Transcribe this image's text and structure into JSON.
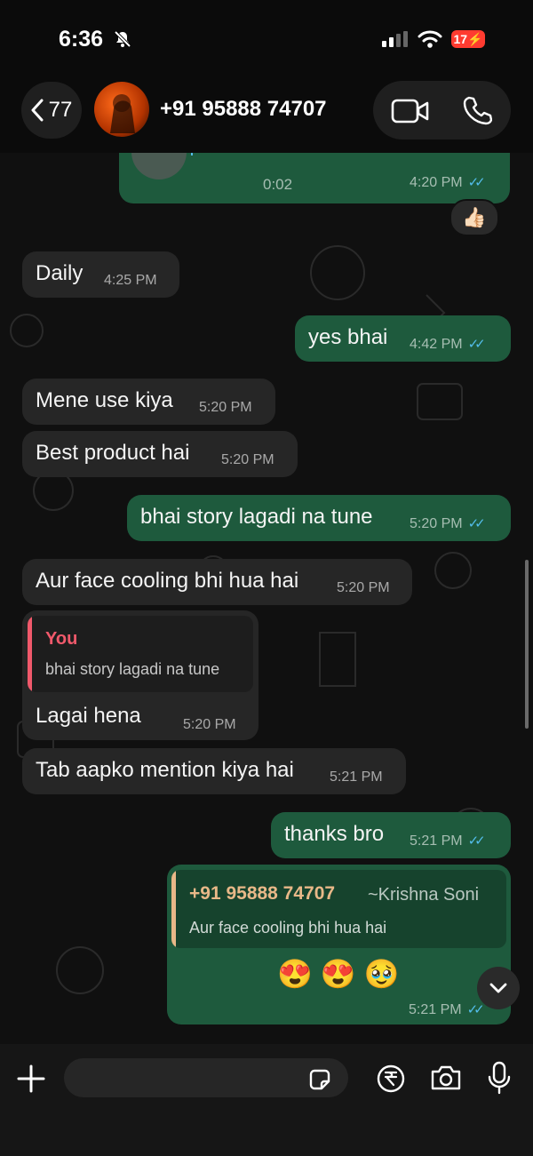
{
  "status_bar": {
    "time": "6:36",
    "battery": "17"
  },
  "header": {
    "back_count": "77",
    "contact": "+91 95888 74707"
  },
  "voice_note": {
    "duration": "0:02",
    "time": "4:20 PM",
    "reaction": "👍🏻"
  },
  "messages": [
    {
      "text": "Daily",
      "time": "4:25 PM"
    },
    {
      "text": "yes bhai",
      "time": "4:42 PM"
    },
    {
      "text": "Mene use kiya",
      "time": "5:20 PM"
    },
    {
      "text": "Best product hai",
      "time": "5:20 PM"
    },
    {
      "text": "bhai story lagadi na tune",
      "time": "5:20 PM"
    },
    {
      "text": "Aur face cooling bhi hua hai",
      "time": "5:20 PM"
    },
    {
      "text": "Lagai hena",
      "time": "5:20 PM",
      "quote_author": "You",
      "quote_text": "bhai story lagadi na tune"
    },
    {
      "text": "Tab aapko mention kiya hai",
      "time": "5:21 PM"
    },
    {
      "text": "thanks bro",
      "time": "5:21 PM"
    },
    {
      "text": "😍 😍 🥹",
      "time": "5:21 PM",
      "quote_author": "+91 95888 74707",
      "quote_author_name": "~Krishna Soni",
      "quote_text": "Aur face cooling bhi hua hai"
    }
  ],
  "colors": {
    "outgoing": "#1e5a3d",
    "incoming": "#262626",
    "read_ticks": "#53bdeb",
    "you_quote": "#f0596b",
    "other_quote": "#e8b888"
  }
}
